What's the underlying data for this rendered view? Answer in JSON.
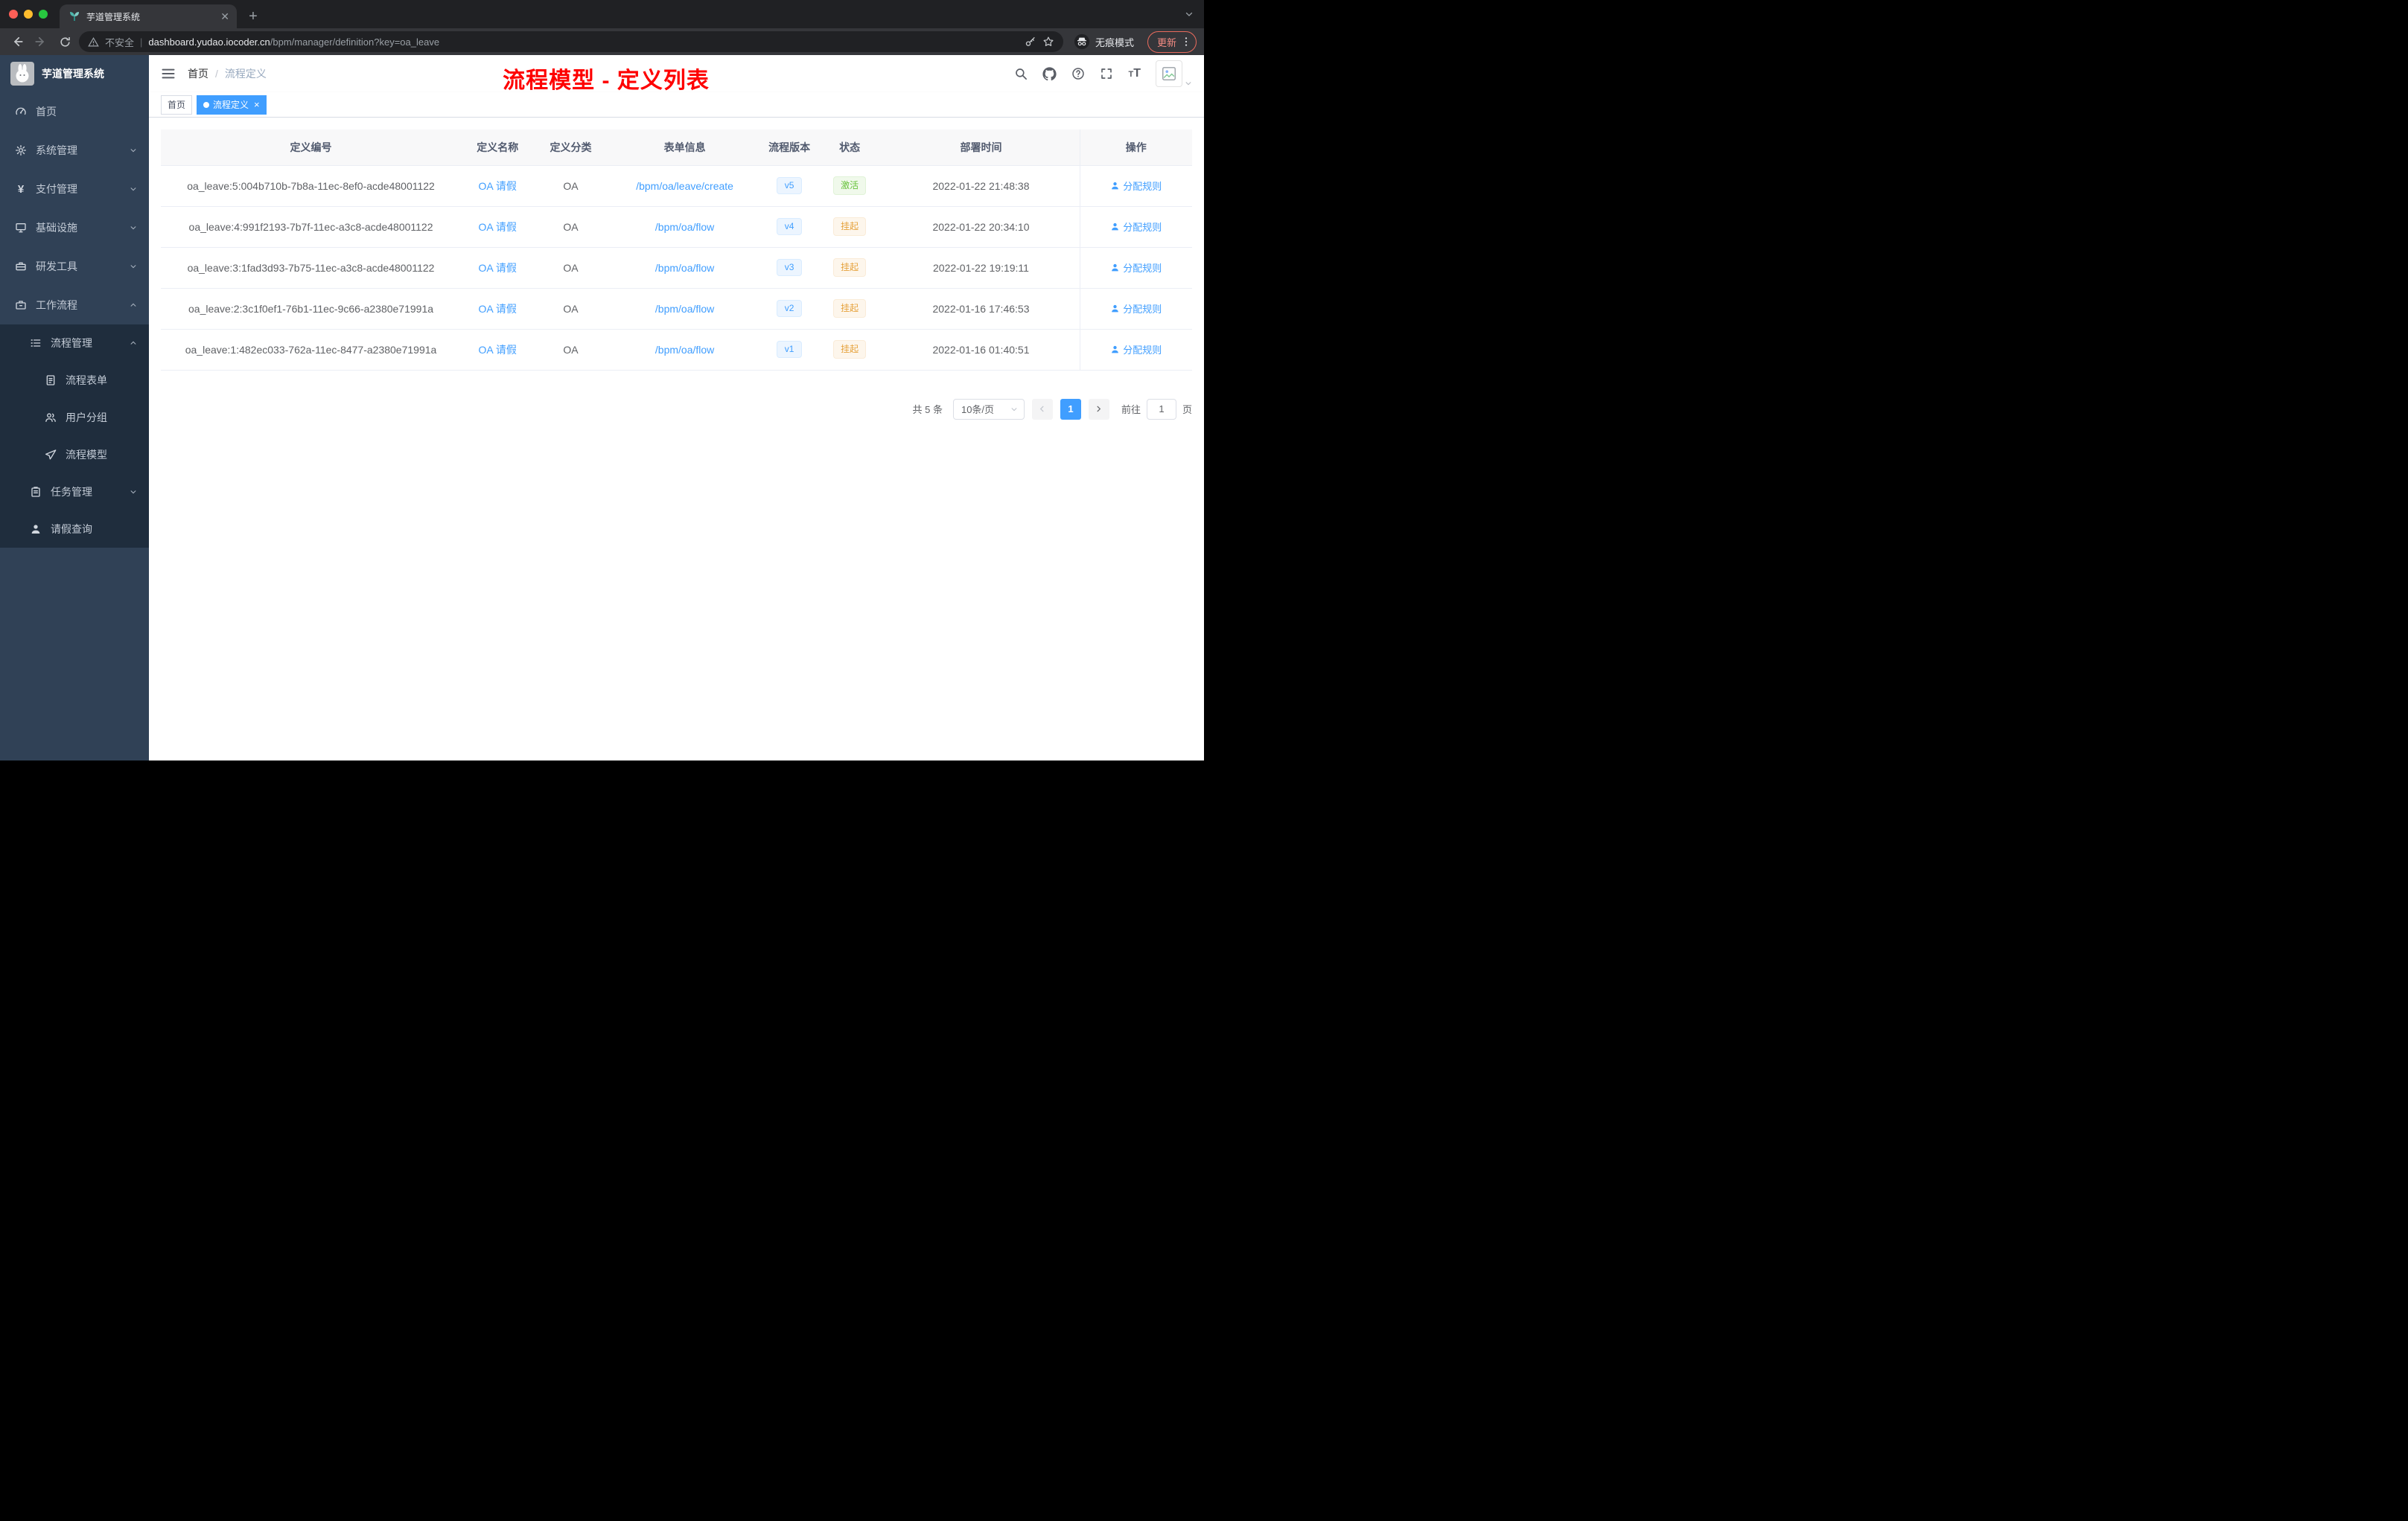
{
  "browser": {
    "tab": {
      "title": "芋道管理系统"
    },
    "security_label": "不安全",
    "url_host": "dashboard.yudao.iocoder.cn",
    "url_path": "/bpm/manager/definition?key=oa_leave",
    "incognito_label": "无痕模式",
    "update_label": "更新"
  },
  "sidebar": {
    "logo_title": "芋道管理系统",
    "items": [
      {
        "label": "首页"
      },
      {
        "label": "系统管理"
      },
      {
        "label": "支付管理"
      },
      {
        "label": "基础设施"
      },
      {
        "label": "研发工具"
      },
      {
        "label": "工作流程"
      },
      {
        "label": "流程管理"
      },
      {
        "label": "流程表单"
      },
      {
        "label": "用户分组"
      },
      {
        "label": "流程模型"
      },
      {
        "label": "任务管理"
      },
      {
        "label": "请假查询"
      }
    ]
  },
  "header": {
    "breadcrumb": {
      "home": "首页",
      "separator": "/",
      "current": "流程定义"
    }
  },
  "annotation": {
    "title": "流程模型 - 定义列表",
    "color": "#fe0000"
  },
  "tags": {
    "items": [
      {
        "label": "首页"
      },
      {
        "label": "流程定义"
      }
    ]
  },
  "table": {
    "columns": [
      "定义编号",
      "定义名称",
      "定义分类",
      "表单信息",
      "流程版本",
      "状态",
      "部署时间",
      "操作"
    ],
    "rows": [
      {
        "id": "oa_leave:5:004b710b-7b8a-11ec-8ef0-acde48001122",
        "name": "OA 请假",
        "category": "OA",
        "form": "/bpm/oa/leave/create",
        "version": "v5",
        "status": "激活",
        "deployed": "2022-01-22 21:48:38",
        "action": "分配规则"
      },
      {
        "id": "oa_leave:4:991f2193-7b7f-11ec-a3c8-acde48001122",
        "name": "OA 请假",
        "category": "OA",
        "form": "/bpm/oa/flow",
        "version": "v4",
        "status": "挂起",
        "deployed": "2022-01-22 20:34:10",
        "action": "分配规则"
      },
      {
        "id": "oa_leave:3:1fad3d93-7b75-11ec-a3c8-acde48001122",
        "name": "OA 请假",
        "category": "OA",
        "form": "/bpm/oa/flow",
        "version": "v3",
        "status": "挂起",
        "deployed": "2022-01-22 19:19:11",
        "action": "分配规则"
      },
      {
        "id": "oa_leave:2:3c1f0ef1-76b1-11ec-9c66-a2380e71991a",
        "name": "OA 请假",
        "category": "OA",
        "form": "/bpm/oa/flow",
        "version": "v2",
        "status": "挂起",
        "deployed": "2022-01-16 17:46:53",
        "action": "分配规则"
      },
      {
        "id": "oa_leave:1:482ec033-762a-11ec-8477-a2380e71991a",
        "name": "OA 请假",
        "category": "OA",
        "form": "/bpm/oa/flow",
        "version": "v1",
        "status": "挂起",
        "deployed": "2022-01-16 01:40:51",
        "action": "分配规则"
      }
    ]
  },
  "pagination": {
    "total": "共 5 条",
    "page_size": "10条/页",
    "current_page": "1",
    "goto_label": "前往",
    "goto_value": "1",
    "page_unit": "页"
  },
  "colors": {
    "accent": "#409eff",
    "success": "#67c23a",
    "warning": "#e6a23c",
    "annotation_red": "#fe0000",
    "sidebar_bg": "#304156",
    "submenu_bg": "#1f2d3d",
    "tag_active_bg": "#409eff"
  }
}
